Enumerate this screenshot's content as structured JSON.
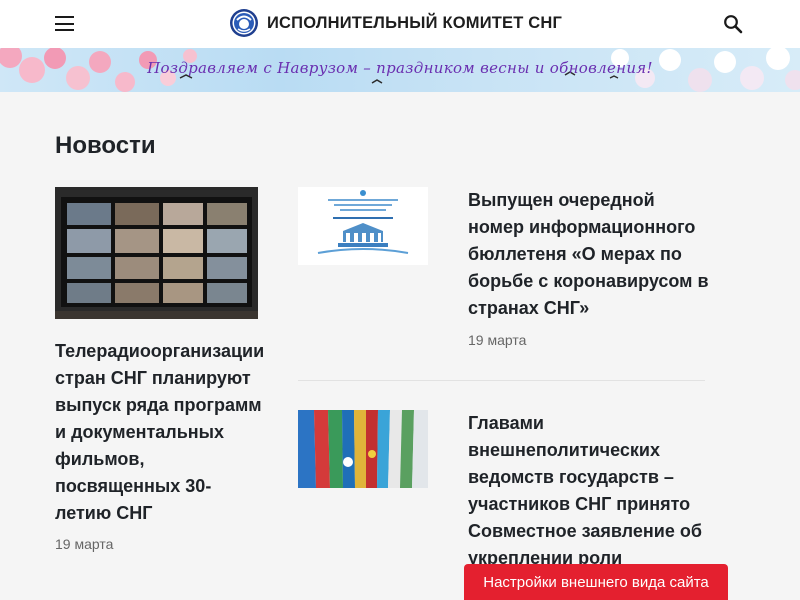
{
  "header": {
    "logo_text": "ИСПОЛНИТЕЛЬНЫЙ КОМИТЕТ СНГ",
    "menu_icon": "hamburger-menu-icon",
    "search_icon": "search-icon"
  },
  "banner": {
    "text": "Поздравляем с Наврузом – праздником весны и обновления!"
  },
  "section_title": "Новости",
  "news": [
    {
      "title": "Телерадиоорганизации стран СНГ планируют выпуск ряда программ и документальных фильмов, посвященных 30-летию СНГ",
      "date": "19 марта"
    },
    {
      "title": "Выпущен очередной номер информационного бюллетеня «О мерах по борьбе с коронавирусом в странах СНГ»",
      "date": "19 марта"
    },
    {
      "title": "Главами внешнеполитических ведомств государств – участников СНГ принято Совместное заявление об укреплении роли",
      "date": ""
    }
  ],
  "settings_button": "Настройки внешнего вида сайта",
  "colors": {
    "accent_red": "#e4202f",
    "text": "#1f2328",
    "background": "#f5f5f5"
  }
}
